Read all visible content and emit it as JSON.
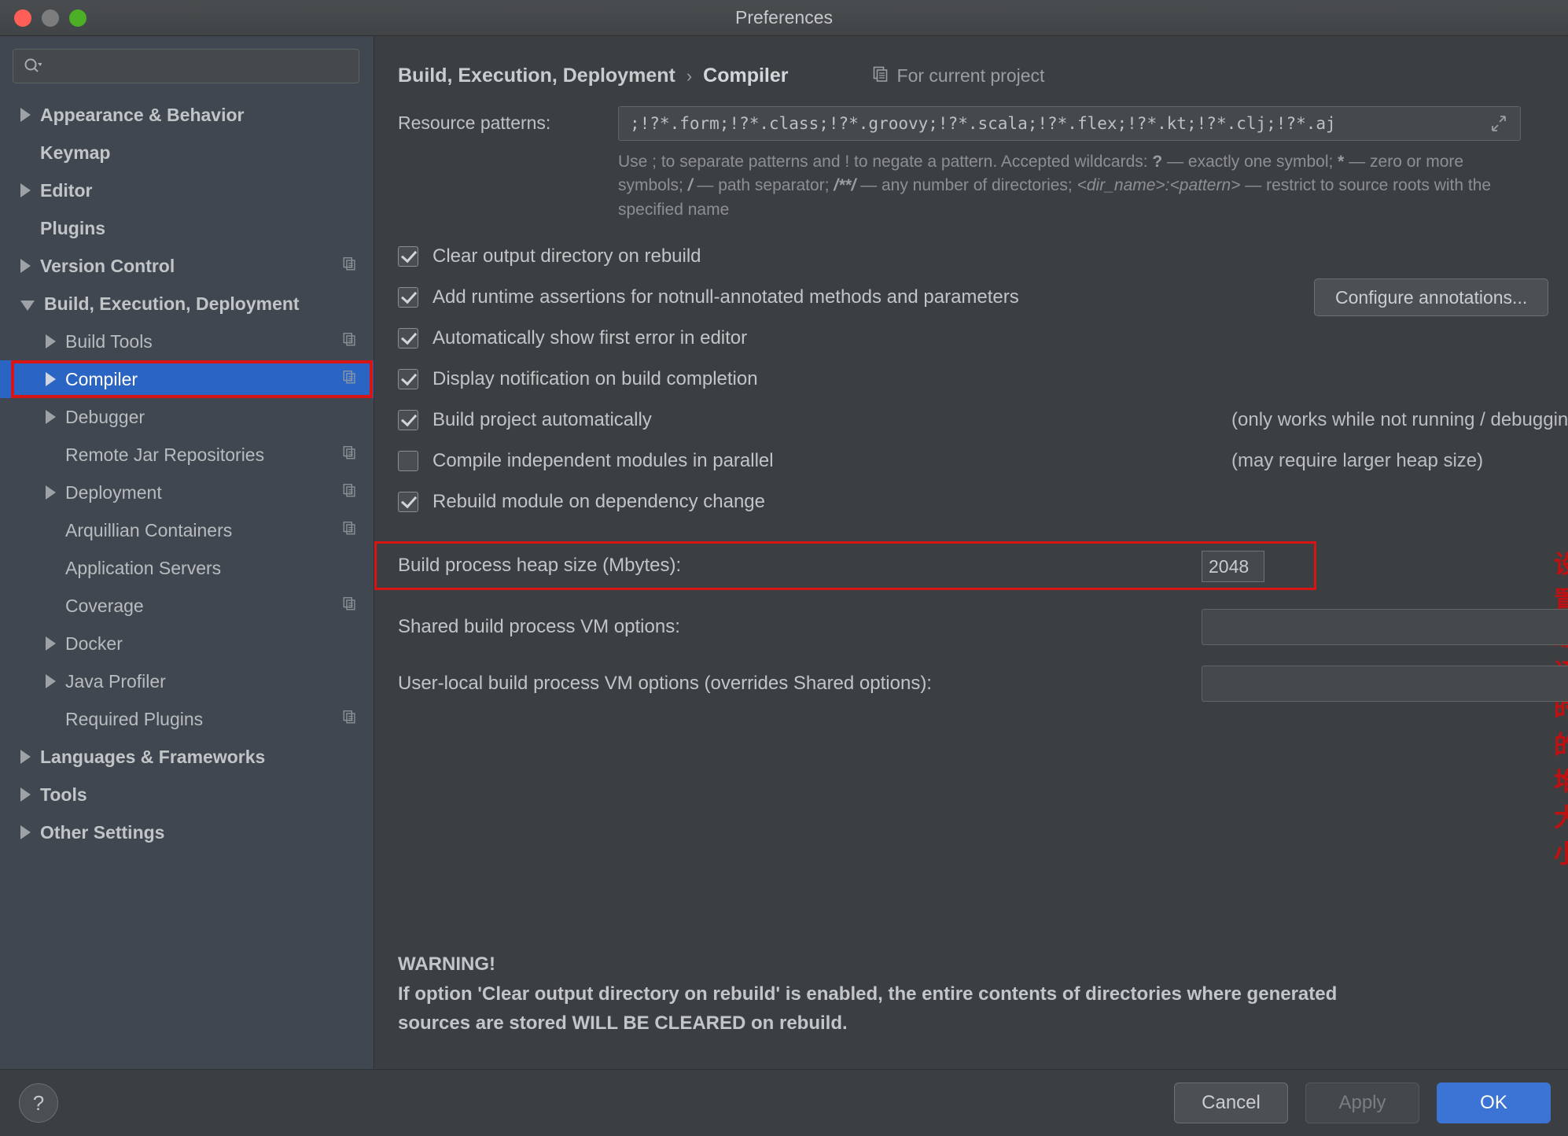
{
  "window": {
    "title": "Preferences",
    "traffic_lights": [
      "close-red",
      "minimize-gray",
      "zoom-green"
    ]
  },
  "search": {
    "placeholder": "",
    "value": "",
    "icon": "search-icon"
  },
  "sidebar": {
    "items": [
      {
        "label": "Appearance & Behavior",
        "level": 0,
        "arrow": "right",
        "bold": true,
        "copy": false,
        "selected": false
      },
      {
        "label": "Keymap",
        "level": 0,
        "arrow": "none",
        "bold": true,
        "copy": false,
        "selected": false
      },
      {
        "label": "Editor",
        "level": 0,
        "arrow": "right",
        "bold": true,
        "copy": false,
        "selected": false
      },
      {
        "label": "Plugins",
        "level": 0,
        "arrow": "none",
        "bold": true,
        "copy": false,
        "selected": false
      },
      {
        "label": "Version Control",
        "level": 0,
        "arrow": "right",
        "bold": true,
        "copy": true,
        "selected": false
      },
      {
        "label": "Build, Execution, Deployment",
        "level": 0,
        "arrow": "down",
        "bold": true,
        "copy": false,
        "selected": false
      },
      {
        "label": "Build Tools",
        "level": 1,
        "arrow": "right",
        "bold": false,
        "copy": true,
        "selected": false
      },
      {
        "label": "Compiler",
        "level": 1,
        "arrow": "right",
        "bold": false,
        "copy": true,
        "selected": true
      },
      {
        "label": "Debugger",
        "level": 1,
        "arrow": "right",
        "bold": false,
        "copy": false,
        "selected": false
      },
      {
        "label": "Remote Jar Repositories",
        "level": 1,
        "arrow": "none",
        "bold": false,
        "copy": true,
        "selected": false
      },
      {
        "label": "Deployment",
        "level": 1,
        "arrow": "right",
        "bold": false,
        "copy": true,
        "selected": false
      },
      {
        "label": "Arquillian Containers",
        "level": 1,
        "arrow": "none",
        "bold": false,
        "copy": true,
        "selected": false
      },
      {
        "label": "Application Servers",
        "level": 1,
        "arrow": "none",
        "bold": false,
        "copy": false,
        "selected": false
      },
      {
        "label": "Coverage",
        "level": 1,
        "arrow": "none",
        "bold": false,
        "copy": true,
        "selected": false
      },
      {
        "label": "Docker",
        "level": 1,
        "arrow": "right",
        "bold": false,
        "copy": false,
        "selected": false
      },
      {
        "label": "Java Profiler",
        "level": 1,
        "arrow": "right",
        "bold": false,
        "copy": false,
        "selected": false
      },
      {
        "label": "Required Plugins",
        "level": 1,
        "arrow": "none",
        "bold": false,
        "copy": true,
        "selected": false
      },
      {
        "label": "Languages & Frameworks",
        "level": 0,
        "arrow": "right",
        "bold": true,
        "copy": false,
        "selected": false
      },
      {
        "label": "Tools",
        "level": 0,
        "arrow": "right",
        "bold": true,
        "copy": false,
        "selected": false
      },
      {
        "label": "Other Settings",
        "level": 0,
        "arrow": "right",
        "bold": true,
        "copy": false,
        "selected": false
      }
    ]
  },
  "header": {
    "crumb_parent": "Build, Execution, Deployment",
    "crumb_sep": "›",
    "crumb_current": "Compiler",
    "for_current_project": "For current project",
    "project_icon": "copy-icon"
  },
  "resource_patterns": {
    "label": "Resource patterns:",
    "value": ";!?*.form;!?*.class;!?*.groovy;!?*.scala;!?*.flex;!?*.kt;!?*.clj;!?*.aj",
    "expand_icon": "expand-arrows-icon",
    "hint_line1_a": "Use ; to separate patterns and ! to negate a pattern. Accepted wildcards: ",
    "hint_q": "?",
    "hint_line1_b": " — exactly one symbol; ",
    "hint_star": "*",
    "hint_line1_c": " — zero",
    "hint_line2_a": "or more symbols; ",
    "hint_slash": "/",
    "hint_line2_b": " — path separator; ",
    "hint_globstar": "/**/",
    "hint_line2_c": " — any number of directories; ",
    "hint_dirpat": "<dir_name>:<pattern>",
    "hint_line2_d": " — restrict to",
    "hint_line3": "source roots with the specified name"
  },
  "options": [
    {
      "label": "Clear output directory on rebuild",
      "checked": true,
      "note": "",
      "button": ""
    },
    {
      "label": "Add runtime assertions for notnull-annotated methods and parameters",
      "checked": true,
      "note": "",
      "button": "Configure annotations..."
    },
    {
      "label": "Automatically show first error in editor",
      "checked": true,
      "note": "",
      "button": ""
    },
    {
      "label": "Display notification on build completion",
      "checked": true,
      "note": "",
      "button": ""
    },
    {
      "label": "Build project automatically",
      "checked": true,
      "note": "(only works while not running / debugging)",
      "button": ""
    },
    {
      "label": "Compile independent modules in parallel",
      "checked": false,
      "note": "(may require larger heap size)",
      "button": ""
    },
    {
      "label": "Rebuild module on dependency change",
      "checked": true,
      "note": "",
      "button": ""
    }
  ],
  "heap": {
    "label": "Build process heap size (Mbytes):",
    "value": "2048",
    "annotation": "设置编译时的堆大小",
    "highlight_color": "#d71515"
  },
  "vm_options": [
    {
      "label": "Shared build process VM options:",
      "value": ""
    },
    {
      "label": "User-local build process VM options (overrides Shared options):",
      "value": ""
    }
  ],
  "warning": {
    "title": "WARNING!",
    "line1": "If option 'Clear output directory on rebuild' is enabled, the entire contents of directories where generated",
    "line2": "sources are stored WILL BE CLEARED on rebuild."
  },
  "footer": {
    "help": "?",
    "cancel": "Cancel",
    "apply": "Apply",
    "ok": "OK"
  }
}
